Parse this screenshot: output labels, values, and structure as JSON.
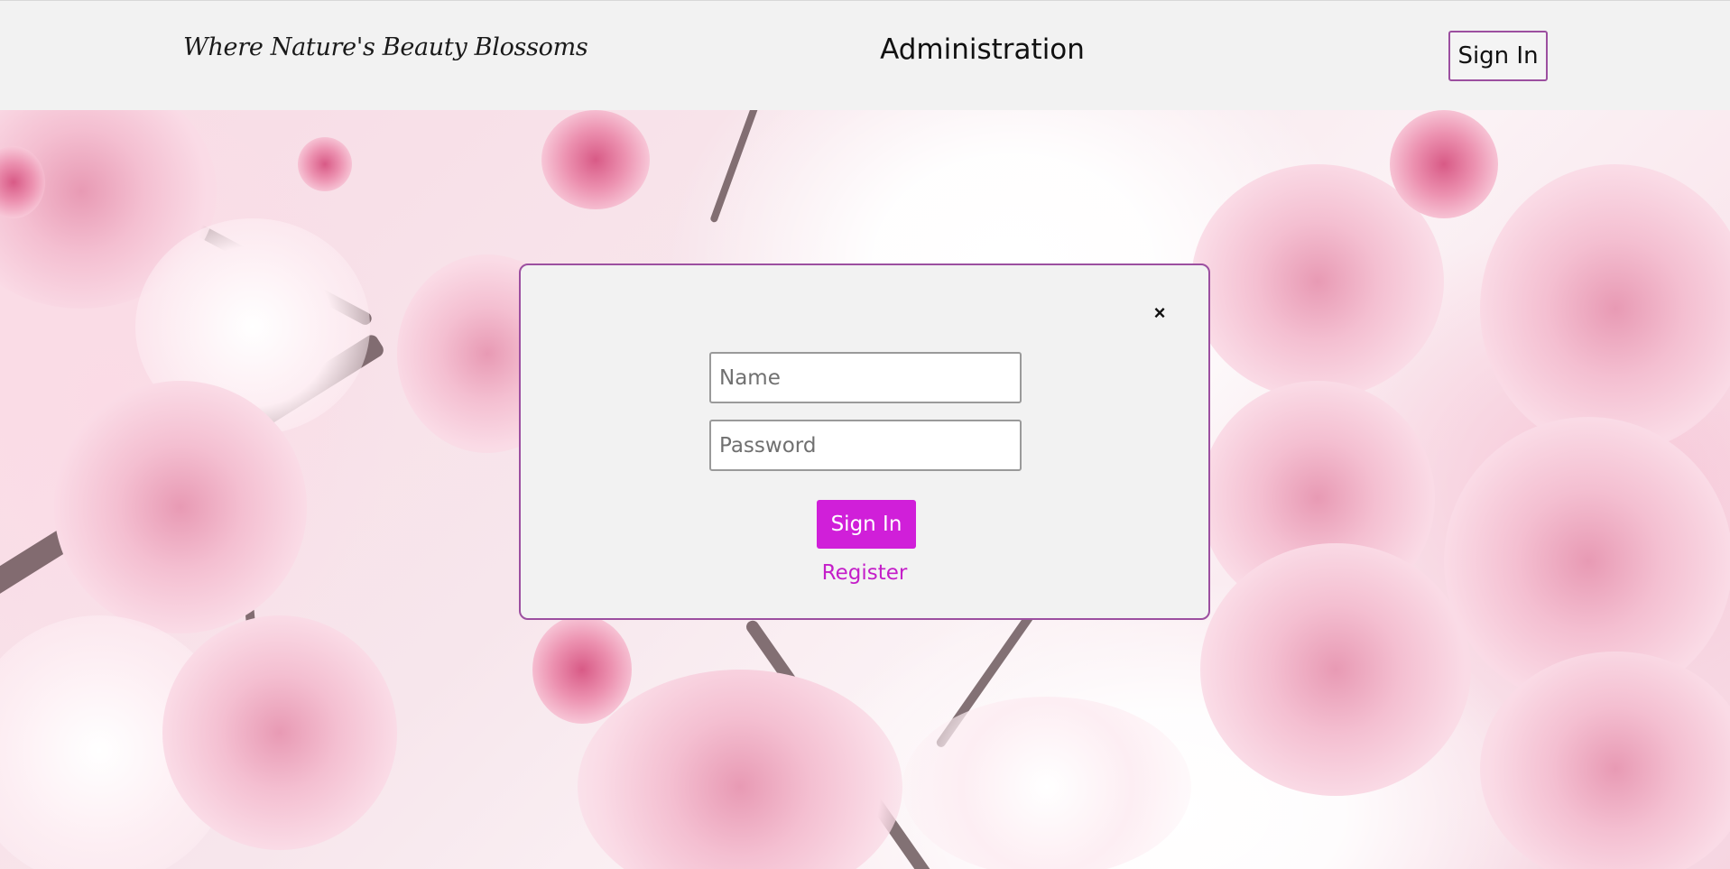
{
  "header": {
    "tagline": "Where Nature's Beauty Blossoms",
    "title": "Administration",
    "signin_label": "Sign In"
  },
  "modal": {
    "close_label": "×",
    "name_placeholder": "Name",
    "password_placeholder": "Password",
    "submit_label": "Sign In",
    "register_label": "Register"
  },
  "colors": {
    "accent": "#d01fd9",
    "border": "#9c4fa0",
    "link": "#c41ec9",
    "panel": "#f2f2f2"
  },
  "background": {
    "icon": "cherry-blossom-photo"
  }
}
